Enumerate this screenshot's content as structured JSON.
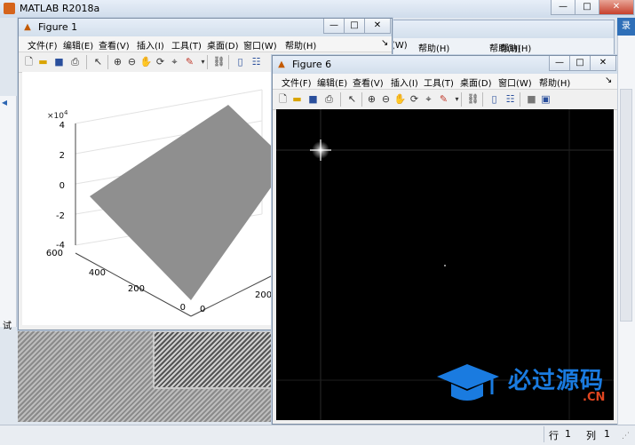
{
  "main": {
    "title": "MATLAB R2018a",
    "caption_buttons": {
      "minimize": "—",
      "maximize": "□",
      "close": "✕"
    },
    "side_fragment": "录",
    "left_fragment": "试",
    "status": {
      "row_label": "行",
      "row_value": "1",
      "col_label": "列",
      "col_value": "1"
    }
  },
  "ghost_menus": [
    {
      "label": "帮助(H)"
    },
    {
      "label": "帮助(H)"
    },
    {
      "label": "帮助(H)"
    }
  ],
  "ghost_fragment": "(W)",
  "figure1": {
    "title": "Figure 1",
    "menu": [
      "文件(F)",
      "编辑(E)",
      "查看(V)",
      "插入(I)",
      "工具(T)",
      "桌面(D)",
      "窗口(W)",
      "帮助(H)"
    ],
    "axes": {
      "z_exponent_base": "×10",
      "z_exponent_power": "4",
      "z_ticks": [
        "4",
        "2",
        "0",
        "-2",
        "-4"
      ],
      "y_ticks": [
        "600",
        "400",
        "200",
        "0"
      ],
      "x_ticks": [
        "0",
        "200"
      ]
    }
  },
  "figure6": {
    "title": "Figure 6",
    "menu": [
      "文件(F)",
      "编辑(E)",
      "查看(V)",
      "插入(I)",
      "工具(T)",
      "桌面(D)",
      "窗口(W)",
      "帮助(H)"
    ]
  },
  "watermark": {
    "text": "必过源码",
    "suffix": ".CN"
  },
  "colors": {
    "surface": "#909090",
    "image_bg": "#000000",
    "watermark_blue": "#1a7be0",
    "watermark_red": "#e04520"
  }
}
